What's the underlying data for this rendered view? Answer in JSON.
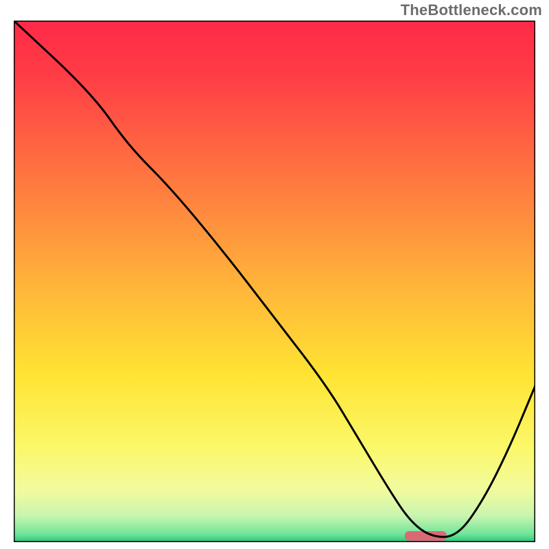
{
  "watermark": "TheBottleneck.com",
  "chart_data": {
    "type": "line",
    "title": "",
    "xlabel": "",
    "ylabel": "",
    "xlim": [
      0,
      100
    ],
    "ylim": [
      0,
      100
    ],
    "grid": false,
    "legend": false,
    "series": [
      {
        "name": "bottleneck-curve",
        "x": [
          0,
          15,
          22,
          30,
          40,
          50,
          60,
          66,
          72,
          76,
          80,
          85,
          90,
          95,
          100
        ],
        "y": [
          100,
          86,
          76,
          68,
          56,
          43,
          30,
          20,
          10,
          4,
          1,
          1,
          8,
          18,
          30
        ]
      }
    ],
    "marker": {
      "name": "optimal-range",
      "x_center": 79,
      "width": 8,
      "color": "#d96a75"
    },
    "gradient_stops": [
      {
        "offset": 0.0,
        "color": "#ff2a47"
      },
      {
        "offset": 0.1,
        "color": "#ff3b46"
      },
      {
        "offset": 0.3,
        "color": "#ff7640"
      },
      {
        "offset": 0.5,
        "color": "#ffb23a"
      },
      {
        "offset": 0.68,
        "color": "#ffe433"
      },
      {
        "offset": 0.82,
        "color": "#fbf86a"
      },
      {
        "offset": 0.9,
        "color": "#f2fb9e"
      },
      {
        "offset": 0.95,
        "color": "#c8f5b0"
      },
      {
        "offset": 0.985,
        "color": "#6fe499"
      },
      {
        "offset": 1.0,
        "color": "#25c679"
      }
    ]
  }
}
